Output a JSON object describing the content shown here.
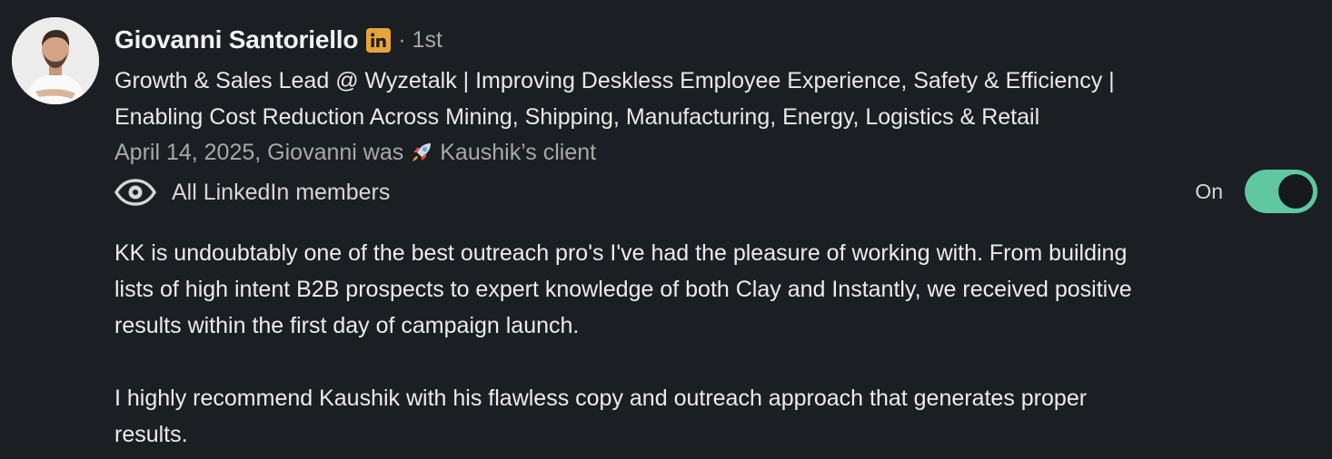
{
  "author": {
    "name": "Giovanni Santoriello",
    "badge_icon": "linkedin-icon",
    "badge_color": "#e7a33e",
    "degree": "· 1st",
    "headline_lines": [
      "Growth & Sales Lead @ Wyzetalk | Improving Deskless Employee Experience, Safety & Efficiency |",
      "Enabling Cost Reduction Across Mining, Shipping, Manufacturing, Energy, Logistics & Retail"
    ]
  },
  "meta": {
    "prefix": "April 14, 2025, Giovanni was",
    "rocket_icon": "rocket-icon",
    "suffix": "Kaushik’s client"
  },
  "visibility": {
    "icon": "eye-icon",
    "label": "All LinkedIn members"
  },
  "toggle": {
    "label": "On",
    "state": "on",
    "accent": "#5fc8a0"
  },
  "recommendation": {
    "paragraph1_lines": [
      "KK is undoubtably one of the best outreach pro's I've had the pleasure of working with. From building",
      "lists of high intent B2B prospects to expert knowledge of both Clay and Instantly, we received positive",
      "results within the first day of campaign launch."
    ],
    "paragraph2_lines": [
      "I highly recommend Kaushik with his flawless copy and outreach approach that generates proper",
      "results."
    ]
  }
}
